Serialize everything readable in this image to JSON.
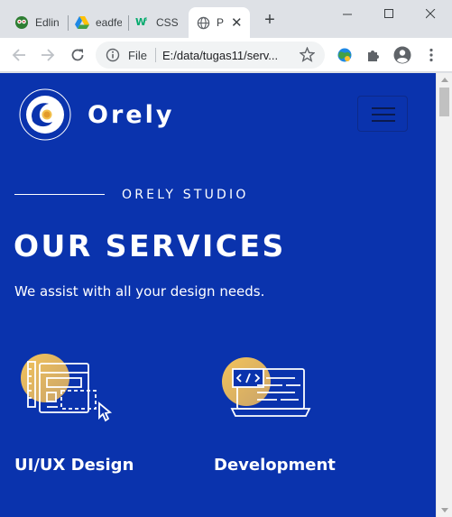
{
  "browser": {
    "tabs": [
      {
        "title": "Edlin",
        "icon": "owl-icon"
      },
      {
        "title": "eadfe",
        "icon": "drive-icon"
      },
      {
        "title": "CSS",
        "icon": "w3schools-icon"
      },
      {
        "title": "P",
        "icon": "globe-icon",
        "active": true
      }
    ],
    "url_scheme": "File",
    "url": "E:/data/tugas11/serv..."
  },
  "site": {
    "brand": "Orely",
    "kicker": "ORELY STUDIO",
    "title": "OUR SERVICES",
    "subtitle": "We assist with all your design needs.",
    "services": [
      {
        "label": "UI/UX Design",
        "icon": "wireframe-design-icon"
      },
      {
        "label": "Development",
        "icon": "laptop-code-icon"
      }
    ]
  },
  "colors": {
    "page_background": "#0a33ad",
    "accent_gold": "#e0b050",
    "text": "#ffffff"
  }
}
